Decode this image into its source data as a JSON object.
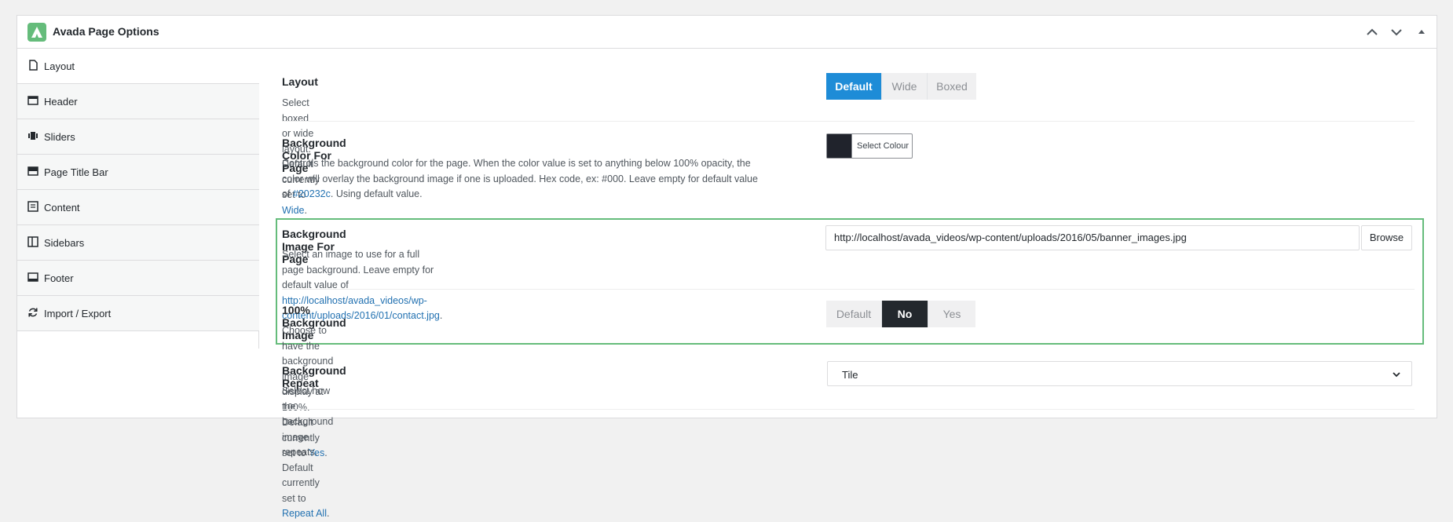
{
  "panel": {
    "title": "Avada Page Options",
    "logo_icon": "avada-logo-icon",
    "brand_color": "#65bc7b"
  },
  "sidebar": {
    "items": [
      {
        "label": "Layout",
        "icon": "page-icon",
        "active": true
      },
      {
        "label": "Header",
        "icon": "header-icon"
      },
      {
        "label": "Sliders",
        "icon": "sliders-icon"
      },
      {
        "label": "Page Title Bar",
        "icon": "page-title-bar-icon"
      },
      {
        "label": "Content",
        "icon": "content-icon"
      },
      {
        "label": "Sidebars",
        "icon": "sidebars-icon"
      },
      {
        "label": "Footer",
        "icon": "footer-icon"
      },
      {
        "label": "Import / Export",
        "icon": "refresh-icon"
      }
    ]
  },
  "options": {
    "layout": {
      "title": "Layout",
      "desc_prefix": "Select boxed or wide layout. Default currently set to ",
      "desc_link": "Wide",
      "desc_suffix": ".",
      "buttons": [
        "Default",
        "Wide",
        "Boxed"
      ],
      "selected": "Default"
    },
    "bg_color": {
      "title": "Background Color For Page",
      "desc_line1": "Controls the background color for the page. When the color value is set to anything below 100% opacity, the",
      "desc_line2": "color will overlay the background image if one is uploaded. Hex code, ex: #000. Leave empty for default value",
      "desc_line3_prefix": "of ",
      "desc_link": "#20232c",
      "desc_line3_suffix": ". Using default value.",
      "button_label": "Select Colour",
      "swatch_color": "#20232c"
    },
    "bg_image": {
      "title": "Background Image For Page",
      "desc_line1": "Select an image to use for a full page background. Leave empty for default value of",
      "desc_link": "http://localhost/avada_videos/wp-content/uploads/2016/01/contact.jpg",
      "desc_suffix": ".",
      "input_value": "http://localhost/avada_videos/wp-content/uploads/2016/05/banner_images.jpg",
      "browse_label": "Browse"
    },
    "bg_full": {
      "title": "100% Background Image",
      "desc_prefix": "Choose to have the background image display at 100%. Default currently set to ",
      "desc_link": "Yes",
      "desc_suffix": ".",
      "buttons": [
        "Default",
        "No",
        "Yes"
      ],
      "selected": "No"
    },
    "bg_repeat": {
      "title": "Background Repeat",
      "desc_prefix": "Select how the background image repeats. Default currently set to ",
      "desc_link": "Repeat All",
      "desc_suffix": ".",
      "select_value": "Tile"
    }
  },
  "colors": {
    "accent_blue": "#1e8cd7",
    "selected_dark": "#23282d",
    "highlight_green": "#65bc7b",
    "link": "#2271b1"
  }
}
